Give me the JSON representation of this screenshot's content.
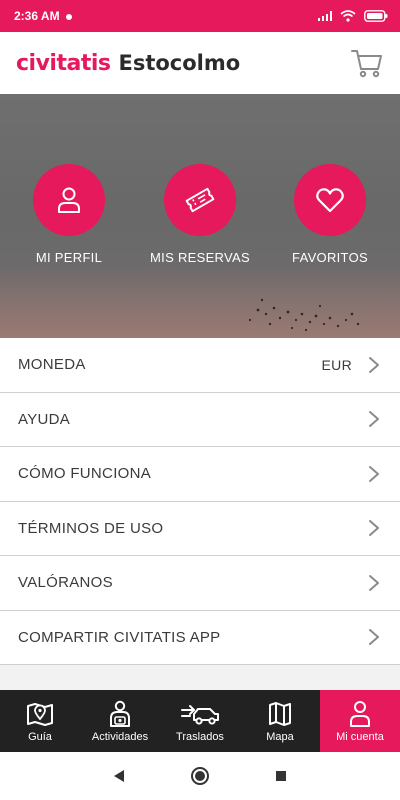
{
  "status_bar": {
    "time": "2:36 AM",
    "icons": [
      "notification-dot",
      "signal-icon",
      "wifi-icon",
      "battery-icon"
    ]
  },
  "header": {
    "brand": "civitatis",
    "city": "Estocolmo",
    "cart_icon": "cart-icon"
  },
  "hero": {
    "items": [
      {
        "label": "MI PERFIL",
        "icon": "user-icon"
      },
      {
        "label": "MIS RESERVAS",
        "icon": "ticket-icon"
      },
      {
        "label": "FAVORITOS",
        "icon": "heart-icon"
      }
    ]
  },
  "menu": {
    "items": [
      {
        "label": "MONEDA",
        "value": "EUR"
      },
      {
        "label": "AYUDA"
      },
      {
        "label": "CÓMO FUNCIONA"
      },
      {
        "label": "TÉRMINOS DE USO"
      },
      {
        "label": "VALÓRANOS"
      },
      {
        "label": "COMPARTIR CIVITATIS APP"
      }
    ]
  },
  "bottom_nav": {
    "items": [
      {
        "label": "Guía",
        "icon": "map-pin-book-icon"
      },
      {
        "label": "Actividades",
        "icon": "guide-person-icon"
      },
      {
        "label": "Traslados",
        "icon": "transfer-car-icon"
      },
      {
        "label": "Mapa",
        "icon": "map-icon"
      },
      {
        "label": "Mi cuenta",
        "icon": "user-icon",
        "active": true
      }
    ]
  },
  "system_nav": [
    "back-icon",
    "home-icon",
    "recents-icon"
  ],
  "colors": {
    "brand": "#e5195b",
    "nav_bg": "#222222",
    "text": "#3b3b3b"
  }
}
